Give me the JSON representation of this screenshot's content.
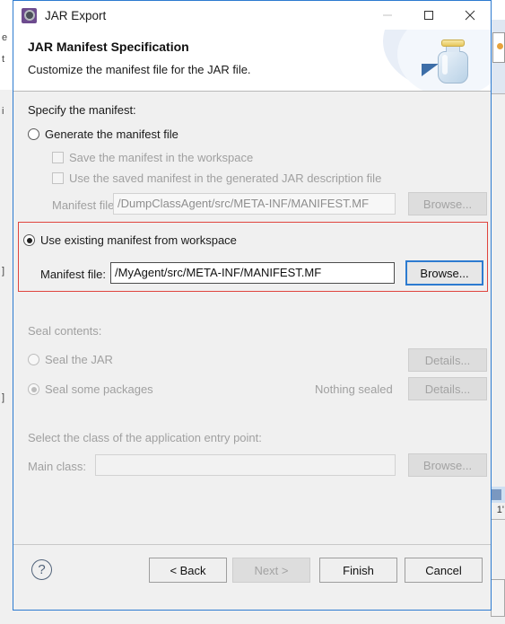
{
  "window": {
    "title": "JAR Export",
    "icon": "jar-export-icon",
    "controls": {
      "minimize": "minimize-icon",
      "maximize": "maximize-icon",
      "close": "close-icon"
    }
  },
  "banner": {
    "title": "JAR Manifest Specification",
    "subtitle": "Customize the manifest file for the JAR file.",
    "art": "jar-bottle-icon"
  },
  "manifest_section": {
    "group_label": "Specify the manifest:",
    "generate_option": {
      "label": "Generate the manifest file",
      "selected": false
    },
    "checkboxes": [
      {
        "label": "Save the manifest in the workspace",
        "checked": false,
        "enabled": false
      },
      {
        "label": "Use the saved manifest in the generated JAR description file",
        "checked": false,
        "enabled": false
      }
    ],
    "generate_file": {
      "label": "Manifest file:",
      "value": "/DumpClassAgent/src/META-INF/MANIFEST.MF",
      "placeholder": "",
      "browse_label": "Browse...",
      "enabled": false
    },
    "existing_option": {
      "label": "Use existing manifest from workspace",
      "selected": true,
      "highlight_color": "#e0443e"
    },
    "existing_file": {
      "label": "Manifest file:",
      "value": "/MyAgent/src/META-INF/MANIFEST.MF",
      "placeholder": "",
      "browse_label": "Browse...",
      "enabled": true,
      "focused": true
    }
  },
  "seal_section": {
    "group_label": "Seal contents:",
    "seal_jar": {
      "label": "Seal the JAR",
      "selected": false,
      "details_label": "Details..."
    },
    "seal_packages": {
      "label": "Seal some packages",
      "selected": true,
      "status": "Nothing sealed",
      "details_label": "Details..."
    }
  },
  "entry_point_section": {
    "group_label": "Select the class of the application entry point:",
    "main_class": {
      "label": "Main class:",
      "value": "",
      "placeholder": "",
      "browse_label": "Browse...",
      "enabled": false
    }
  },
  "footer": {
    "help": "help-icon",
    "buttons": [
      {
        "label": "< Back",
        "enabled": true
      },
      {
        "label": "Next >",
        "enabled": false
      },
      {
        "label": "Finish",
        "enabled": true
      },
      {
        "label": "Cancel",
        "enabled": true
      }
    ]
  },
  "background": {
    "left_snippet_1": "e",
    "left_snippet_2": "t",
    "left_snippet_3": "i",
    "left_snippet_4": "]",
    "left_snippet_5": "]",
    "right_snippet": "1'"
  }
}
